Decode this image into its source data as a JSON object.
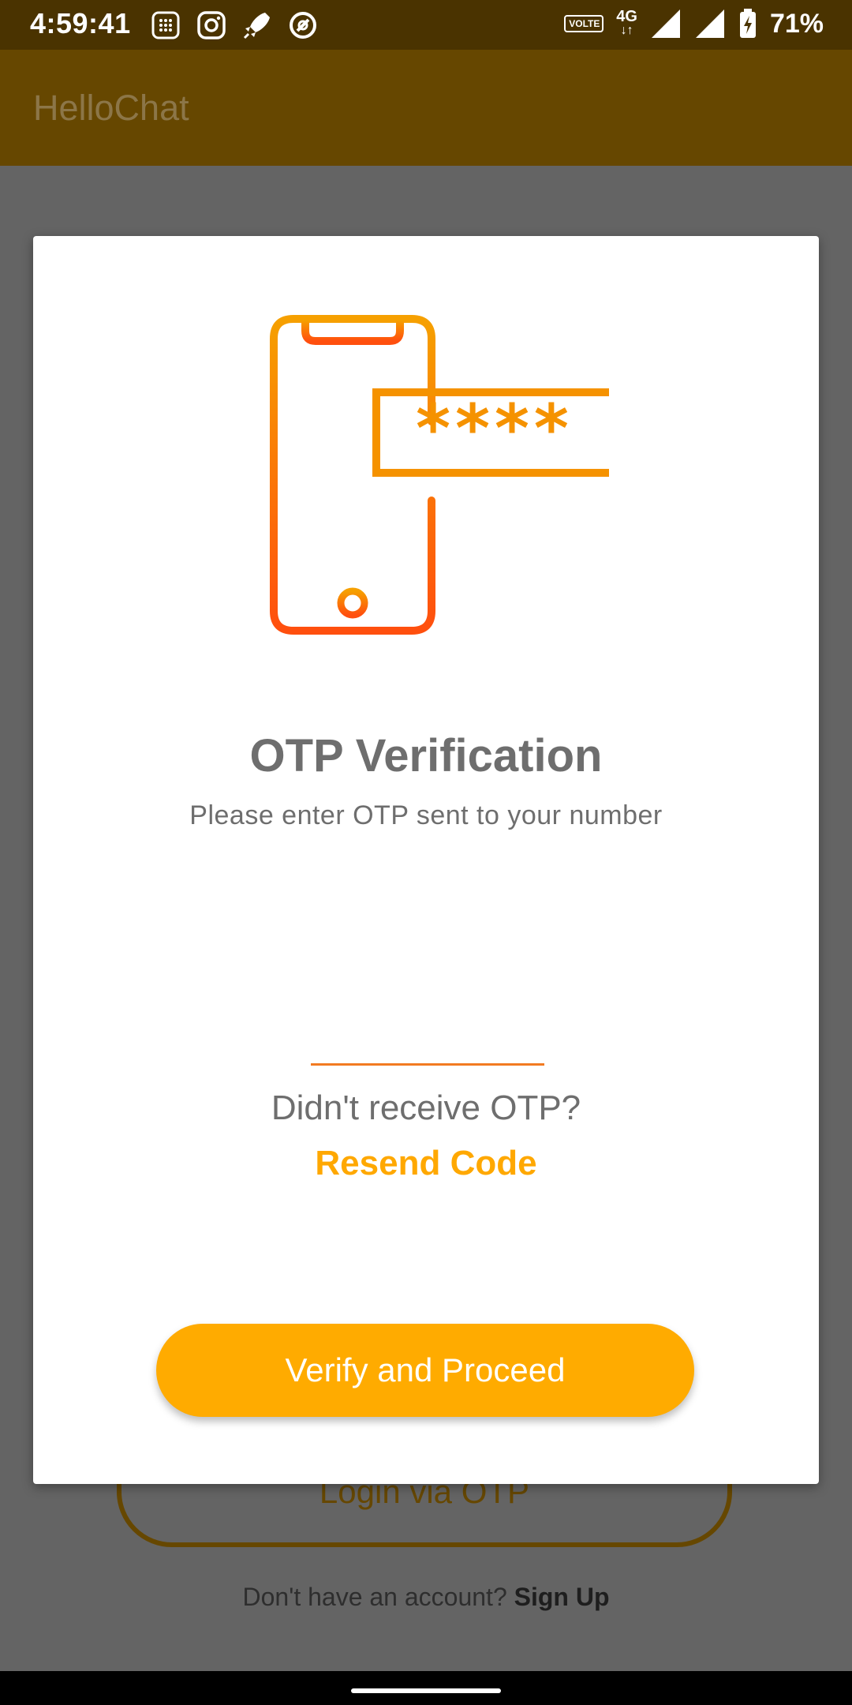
{
  "status_bar": {
    "time": "4:59:41",
    "network_type": "4G",
    "volte_label": "VOLTE",
    "battery_percent": "71%",
    "left_icons": [
      "calculator-icon",
      "instagram-icon",
      "rocket-icon",
      "notification-icon"
    ],
    "right_icons": [
      "volte-icon",
      "4g-icon",
      "signal-icon",
      "signal-icon",
      "battery-charging-icon"
    ]
  },
  "app_bar": {
    "title": "HelloChat"
  },
  "dialog": {
    "title": "OTP Verification",
    "subtitle": "Please enter OTP sent to your number",
    "otp_input": {
      "value": "",
      "placeholder": ""
    },
    "resend_question": "Didn't receive OTP?",
    "resend_link": "Resend Code",
    "verify_button": "Verify and Proceed",
    "illustration": {
      "icon": "phone-otp-icon",
      "masked_code": "****"
    }
  },
  "background": {
    "login_otp_button": "Login via OTP",
    "signup_prompt": "Don't have an account?",
    "signup_link": "Sign Up"
  },
  "colors": {
    "status_bar": "#4a3300",
    "app_bar": "#664700",
    "accent": "#ffab00",
    "gradient_top": "#f6a000",
    "gradient_bottom": "#ff4f0e",
    "overlay": "#646464"
  }
}
